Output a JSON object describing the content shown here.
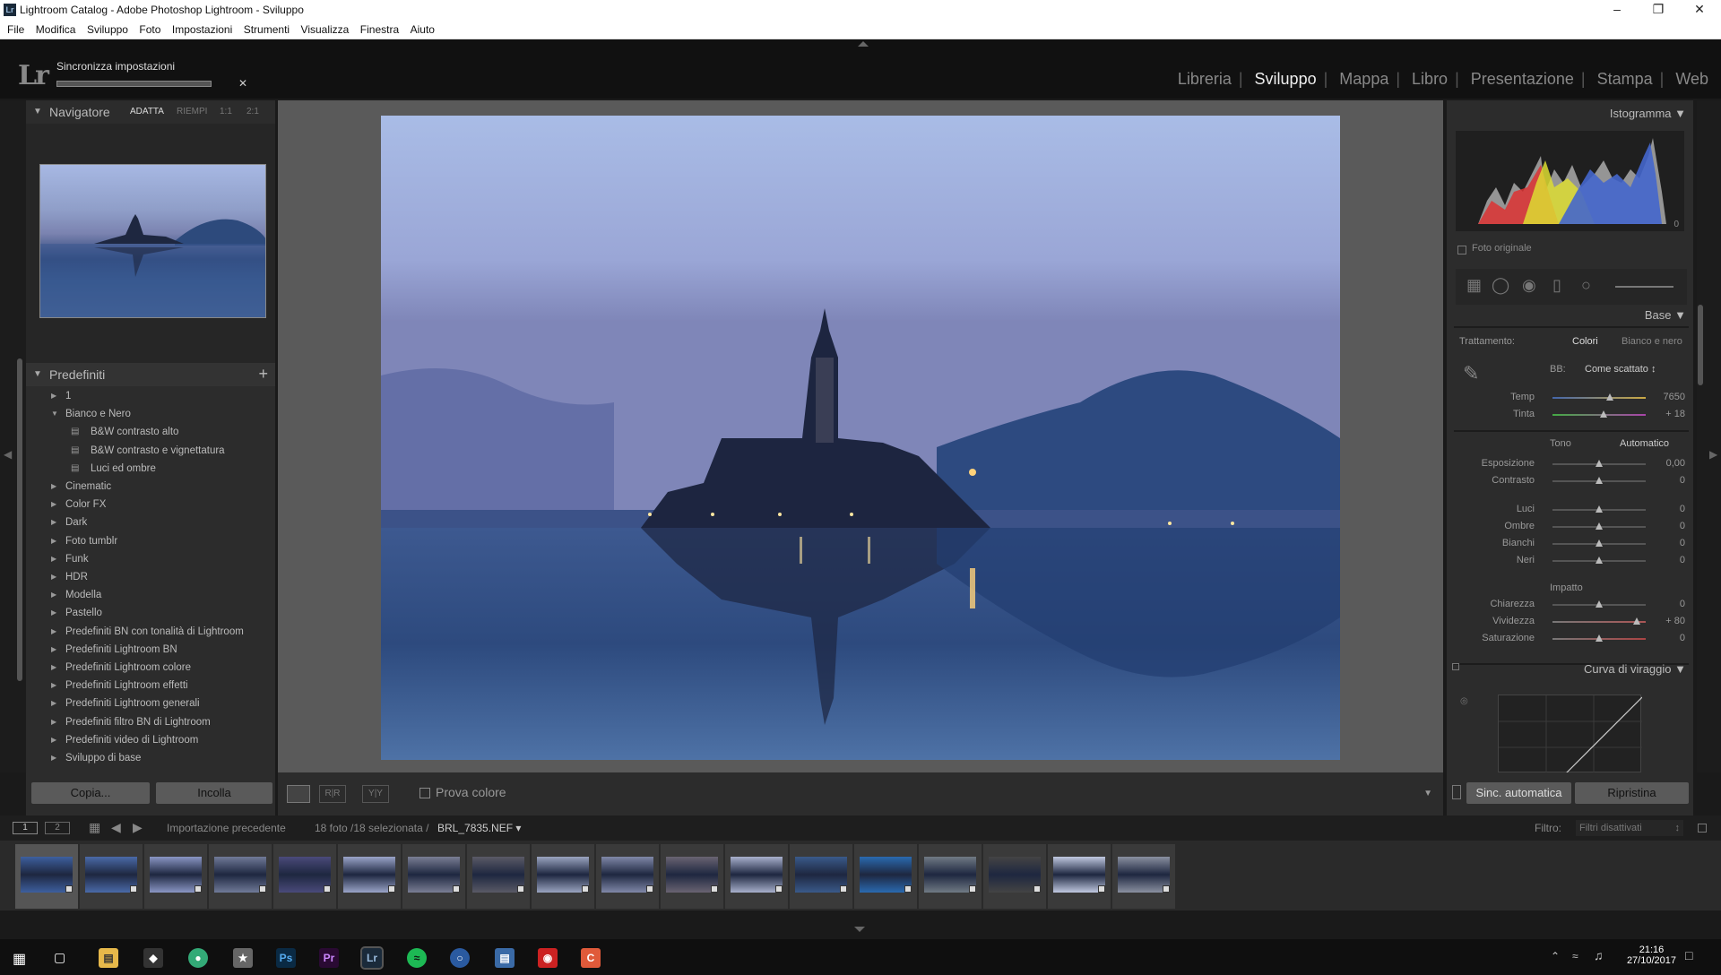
{
  "window": {
    "title": "Lightroom Catalog - Adobe Photoshop Lightroom - Sviluppo",
    "app_icon_text": "Lr"
  },
  "menu": [
    "File",
    "Modifica",
    "Sviluppo",
    "Foto",
    "Impostazioni",
    "Strumenti",
    "Visualizza",
    "Finestra",
    "Aiuto"
  ],
  "topbar": {
    "logo": "Lr",
    "sync_label": "Sincronizza impostazioni"
  },
  "modules": [
    "Libreria",
    "Sviluppo",
    "Mappa",
    "Libro",
    "Presentazione",
    "Stampa",
    "Web"
  ],
  "active_module": "Sviluppo",
  "navigator": {
    "title": "Navigatore",
    "zoom_fit": "ADATTA",
    "zoom_fill": "RIEMPI",
    "zoom_1": "1:1",
    "zoom_2": "2:1"
  },
  "presets": {
    "title": "Predefiniti",
    "items": [
      {
        "label": "1",
        "open": false,
        "level": 0
      },
      {
        "label": "Bianco e Nero",
        "open": true,
        "level": 0
      },
      {
        "label": "B&W contrasto alto",
        "level": 1
      },
      {
        "label": "B&W contrasto e vignettatura",
        "level": 1
      },
      {
        "label": "Luci ed ombre",
        "level": 1
      },
      {
        "label": "Cinematic",
        "open": false,
        "level": 0
      },
      {
        "label": "Color FX",
        "open": false,
        "level": 0
      },
      {
        "label": "Dark",
        "open": false,
        "level": 0
      },
      {
        "label": "Foto tumblr",
        "open": false,
        "level": 0
      },
      {
        "label": "Funk",
        "open": false,
        "level": 0
      },
      {
        "label": "HDR",
        "open": false,
        "level": 0
      },
      {
        "label": "Modella",
        "open": false,
        "level": 0
      },
      {
        "label": "Pastello",
        "open": false,
        "level": 0
      },
      {
        "label": "Predefiniti BN con tonalità di Lightroom",
        "open": false,
        "level": 0
      },
      {
        "label": "Predefiniti Lightroom BN",
        "open": false,
        "level": 0
      },
      {
        "label": "Predefiniti Lightroom colore",
        "open": false,
        "level": 0
      },
      {
        "label": "Predefiniti Lightroom effetti",
        "open": false,
        "level": 0
      },
      {
        "label": "Predefiniti Lightroom generali",
        "open": false,
        "level": 0
      },
      {
        "label": "Predefiniti filtro BN di Lightroom",
        "open": false,
        "level": 0
      },
      {
        "label": "Predefiniti video di Lightroom",
        "open": false,
        "level": 0
      },
      {
        "label": "Sviluppo di base",
        "open": false,
        "level": 0
      }
    ]
  },
  "left_buttons": {
    "copy": "Copia...",
    "paste": "Incolla"
  },
  "toolbar": {
    "softproof": "Prova colore",
    "yy": "Y|Y",
    "rr": "R|R"
  },
  "histogram": {
    "title": "Istogramma",
    "original": "Foto originale",
    "value": "0"
  },
  "basic": {
    "title": "Base",
    "treatment_label": "Trattamento:",
    "treatment_color": "Colori",
    "treatment_bw": "Bianco e nero",
    "wb_label": "BB:",
    "wb_value": "Come scattato",
    "tone_label": "Tono",
    "auto": "Automatico",
    "presence_label": "Impatto",
    "sliders": [
      {
        "label": "Temp",
        "value": "7650",
        "pos": 0.62
      },
      {
        "label": "Tinta",
        "value": "+ 18",
        "pos": 0.55
      },
      {
        "label": "Esposizione",
        "value": "0,00",
        "pos": 0.5
      },
      {
        "label": "Contrasto",
        "value": "0",
        "pos": 0.5
      },
      {
        "label": "Luci",
        "value": "0",
        "pos": 0.5
      },
      {
        "label": "Ombre",
        "value": "0",
        "pos": 0.5
      },
      {
        "label": "Bianchi",
        "value": "0",
        "pos": 0.5
      },
      {
        "label": "Neri",
        "value": "0",
        "pos": 0.5
      },
      {
        "label": "Chiarezza",
        "value": "0",
        "pos": 0.5
      },
      {
        "label": "Vividezza",
        "value": "+ 80",
        "pos": 0.9
      },
      {
        "label": "Saturazione",
        "value": "0",
        "pos": 0.5
      }
    ]
  },
  "tone_curve": {
    "title": "Curva di viraggio"
  },
  "right_buttons": {
    "sync": "Sinc. automatica",
    "reset": "Ripristina"
  },
  "filmstrip_header": {
    "page1": "1",
    "page2": "2",
    "source": "Importazione precedente",
    "count": "18 foto /18 selezionata /",
    "file": "BRL_7835.NEF",
    "filter_label": "Filtro:",
    "filter_value": "Filtri disattivati"
  },
  "filmstrip_count": 18,
  "taskbar": {
    "time": "21:16",
    "date": "27/10/2017"
  },
  "colors": {
    "accent": "#eeeeee",
    "panel": "#2c2c2c",
    "bg": "#111111"
  }
}
